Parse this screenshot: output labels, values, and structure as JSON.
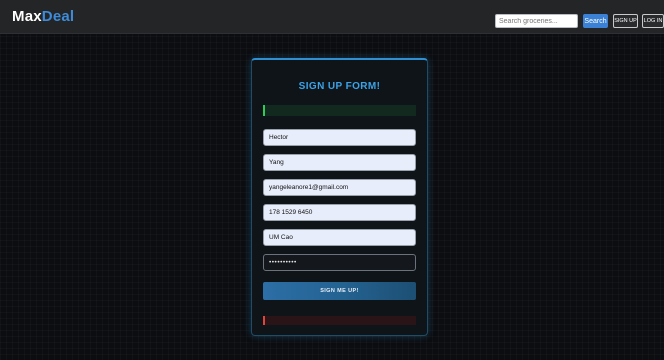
{
  "navbar": {
    "brand_part1": "Max",
    "brand_part2": "Deal",
    "search_placeholder": "Search groceries...",
    "search_button": "Search",
    "signup_button": "SIGN UP",
    "login_button": "LOG IN"
  },
  "form": {
    "title": "SIGN UP FORM!",
    "fields": {
      "first_name": "Hector",
      "last_name": "Yang",
      "email": "yangeleanore1@gmail.com",
      "phone": "178 1529 6450",
      "address": "UM Cao",
      "password": "••••••••••"
    },
    "submit_label": "SIGN ME UP!"
  },
  "colors": {
    "accent": "#3ba3e8",
    "brand_accent": "#3d8bd9",
    "success": "#2ecc55",
    "error": "#e0443a"
  }
}
